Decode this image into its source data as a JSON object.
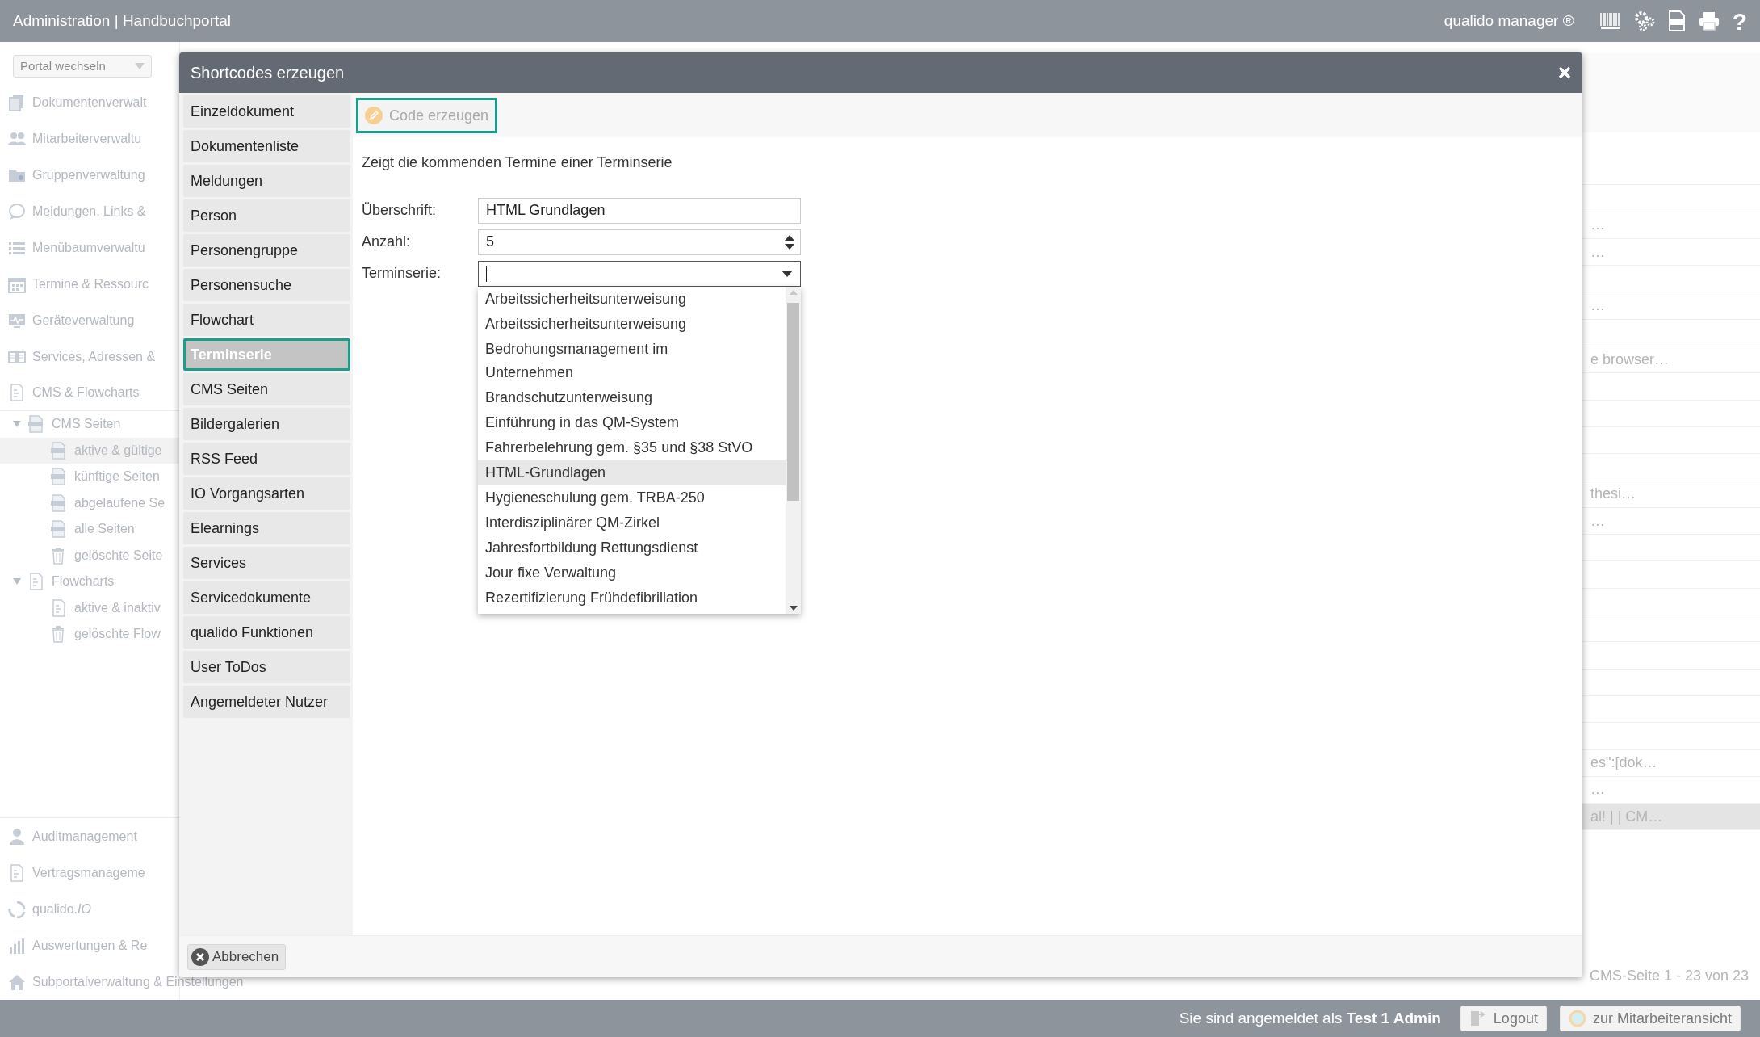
{
  "top_bar": {
    "title": "Administration | Handbuchportal",
    "product": "qualido manager ®",
    "help_label": "?"
  },
  "sidebar": {
    "portal_select": {
      "value": "Portal wechseln"
    },
    "modules": [
      {
        "label": "Dokumentenverwalt"
      },
      {
        "label": "Mitarbeiterverwaltu"
      },
      {
        "label": "Gruppenverwaltung"
      },
      {
        "label": "Meldungen, Links &"
      },
      {
        "label": "Menübaumverwaltu"
      },
      {
        "label": "Termine & Ressourc"
      },
      {
        "label": "Geräteverwaltung"
      },
      {
        "label": "Services, Adressen &"
      },
      {
        "label": "CMS & Flowcharts"
      }
    ],
    "tree": [
      {
        "label": "CMS Seiten",
        "kind": "page",
        "expanded": true,
        "children": [
          {
            "label": "aktive & gültige",
            "kind": "page",
            "selected": true
          },
          {
            "label": "künftige Seiten",
            "kind": "page",
            "selected": false
          },
          {
            "label": "abgelaufene Se",
            "kind": "page",
            "selected": false
          },
          {
            "label": "alle Seiten",
            "kind": "page",
            "selected": false
          },
          {
            "label": "gelöschte Seite",
            "kind": "trash",
            "selected": false
          }
        ]
      },
      {
        "label": "Flowcharts",
        "kind": "flowchart",
        "expanded": true,
        "children": [
          {
            "label": "aktive & inaktiv",
            "kind": "flowchart",
            "selected": false
          },
          {
            "label": "gelöschte Flow",
            "kind": "trash",
            "selected": false
          }
        ]
      }
    ],
    "bottom_modules": [
      {
        "label": "Auditmanagement"
      },
      {
        "label": "Vertragsmanageme"
      },
      {
        "label": "qualido.*IO*"
      },
      {
        "label": "Auswertungen & Re"
      },
      {
        "label": "Subportalverwaltung & Einstellungen"
      }
    ]
  },
  "background_table": {
    "rows": [
      {
        "selected": false
      },
      {
        "selected": false
      },
      {
        "text": "…",
        "selected": false
      },
      {
        "text": "…",
        "selected": false
      },
      {
        "selected": false
      },
      {
        "text": "…",
        "selected": false
      },
      {
        "selected": false
      },
      {
        "text": "e browser…",
        "selected": false
      },
      {
        "selected": false
      },
      {
        "selected": false
      },
      {
        "selected": false
      },
      {
        "selected": false
      },
      {
        "text": "thesi…",
        "selected": false
      },
      {
        "text": "…",
        "selected": false
      },
      {
        "selected": false
      },
      {
        "selected": false
      },
      {
        "selected": false
      },
      {
        "selected": false
      },
      {
        "selected": false
      },
      {
        "selected": false
      },
      {
        "selected": false
      },
      {
        "selected": false
      },
      {
        "text": "es\":[dok…",
        "selected": false
      },
      {
        "text": "…",
        "selected": false
      },
      {
        "text": "al! | | CM…",
        "selected": true
      }
    ],
    "footer": "CMS-Seite 1 - 23 von 23"
  },
  "modal": {
    "title": "Shortcodes erzeugen",
    "types": [
      {
        "label": "Einzeldokument",
        "selected": false
      },
      {
        "label": "Dokumentenliste",
        "selected": false
      },
      {
        "label": "Meldungen",
        "selected": false
      },
      {
        "label": "Person",
        "selected": false
      },
      {
        "label": "Personengruppe",
        "selected": false
      },
      {
        "label": "Personensuche",
        "selected": false
      },
      {
        "label": "Flowchart",
        "selected": false
      },
      {
        "label": "Terminserie",
        "selected": true
      },
      {
        "label": "CMS Seiten",
        "selected": false
      },
      {
        "label": "Bildergalerien",
        "selected": false
      },
      {
        "label": "RSS Feed",
        "selected": false
      },
      {
        "label": "IO Vorgangsarten",
        "selected": false
      },
      {
        "label": "Elearnings",
        "selected": false
      },
      {
        "label": "Services",
        "selected": false
      },
      {
        "label": "Servicedokumente",
        "selected": false
      },
      {
        "label": "qualido Funktionen",
        "selected": false
      },
      {
        "label": "User ToDos",
        "selected": false
      },
      {
        "label": "Angemeldeter Nutzer",
        "selected": false
      }
    ],
    "generate_button": {
      "label": "Code erzeugen",
      "disabled": true
    },
    "description": "Zeigt die kommenden Termine einer Terminserie",
    "fields": [
      {
        "label": "Überschrift:",
        "kind": "text",
        "value": "HTML Grundlagen"
      },
      {
        "label": "Anzahl:",
        "kind": "number",
        "value": "5"
      },
      {
        "label": "Terminserie:",
        "kind": "select",
        "focused": true,
        "expanded": true,
        "options": [
          {
            "label": "Arbeitssicherheitsunterweisung",
            "selected": false
          },
          {
            "label": "Arbeitssicherheitsunterweisung",
            "selected": false
          },
          {
            "label": "Bedrohungsmanagement im\nUnternehmen",
            "selected": false
          },
          {
            "label": "Brandschutzunterweisung",
            "selected": false
          },
          {
            "label": "Einführung in das QM-System",
            "selected": false
          },
          {
            "label": "Fahrerbelehrung gem. §35 und §38 StVO",
            "selected": false
          },
          {
            "label": "HTML-Grundlagen",
            "selected": true
          },
          {
            "label": "Hygieneschulung gem. TRBA-250",
            "selected": false
          },
          {
            "label": "Interdisziplinärer QM-Zirkel",
            "selected": false
          },
          {
            "label": "Jahresfortbildung Rettungsdienst",
            "selected": false
          },
          {
            "label": "Jour fixe Verwaltung",
            "selected": false
          },
          {
            "label": "Rezertifizierung Frühdefibrillation",
            "selected": false
          }
        ]
      }
    ],
    "cancel_button": "Abbrechen"
  },
  "bottom_bar": {
    "login_text": "Sie sind angemeldet als **Test 1 Admin**",
    "buttons": [
      {
        "label": "Logout",
        "kind": "logout"
      },
      {
        "label": "zur Mitarbeiteransicht",
        "kind": "employee"
      }
    ]
  }
}
